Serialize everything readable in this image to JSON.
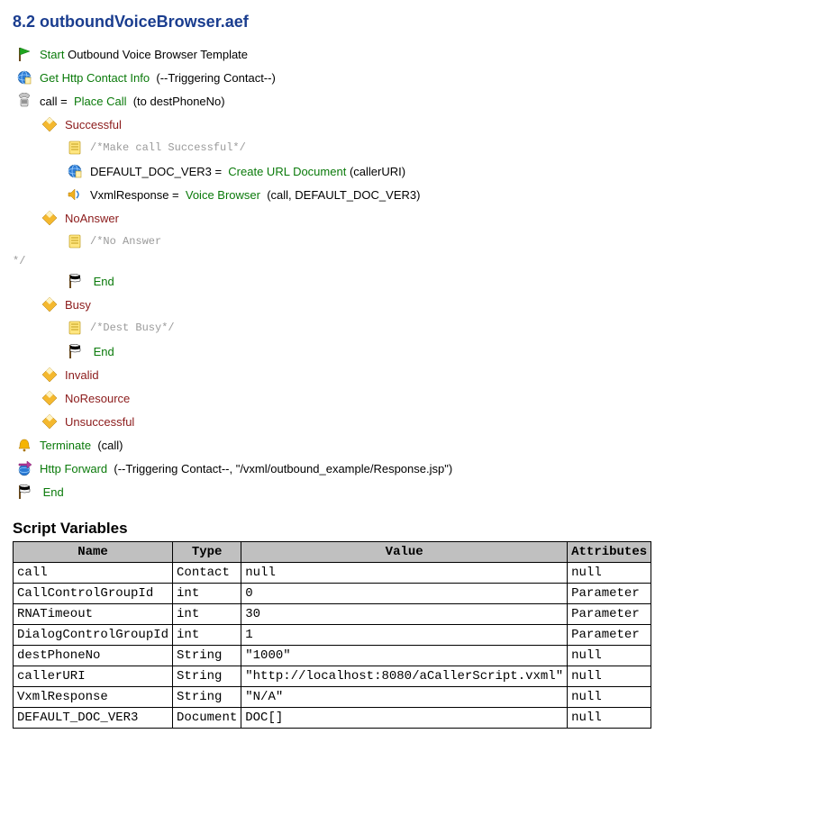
{
  "heading": "8.2 outboundVoiceBrowser.aef",
  "tree": {
    "start_action": "Start",
    "start_label": "Outbound Voice Browser Template",
    "gethttp_action": "Get Http Contact Info",
    "gethttp_args": "(--Triggering Contact--)",
    "call_assign": "call = ",
    "placecall_action": "Place Call",
    "placecall_args": "(to destPhoneNo)",
    "successful": "Successful",
    "cmt_success": "/*Make call Successful*/",
    "defdoc_assign": "DEFAULT_DOC_VER3 = ",
    "createurl_action": "Create URL Document",
    "createurl_args": "(callerURI)",
    "vxml_assign": "VxmlResponse = ",
    "voicebrowser_action": "Voice Browser",
    "voicebrowser_args": "(call, DEFAULT_DOC_VER3)",
    "noanswer": "NoAnswer",
    "cmt_noanswer": "/*No Answer",
    "cmt_noanswer_tail": "*/",
    "end": "End",
    "busy": "Busy",
    "cmt_busy": "/*Dest Busy*/",
    "invalid": "Invalid",
    "noresource": "NoResource",
    "unsuccessful": "Unsuccessful",
    "terminate_action": "Terminate",
    "terminate_args": "(call)",
    "httpfwd_action": "Http Forward",
    "httpfwd_args": "(--Triggering Contact--, \"/vxml/outbound_example/Response.jsp\")"
  },
  "vars_heading": "Script Variables",
  "vars_headers": {
    "name": "Name",
    "type": "Type",
    "value": "Value",
    "attrs": "Attributes"
  },
  "vars": [
    {
      "name": "call",
      "type": "Contact",
      "value": "null",
      "attrs": "null"
    },
    {
      "name": "CallControlGroupId",
      "type": "int",
      "value": "0",
      "attrs": "Parameter"
    },
    {
      "name": "RNATimeout",
      "type": "int",
      "value": "30",
      "attrs": "Parameter"
    },
    {
      "name": "DialogControlGroupId",
      "type": "int",
      "value": "1",
      "attrs": "Parameter"
    },
    {
      "name": "destPhoneNo",
      "type": "String",
      "value": "\"1000\"",
      "attrs": "null"
    },
    {
      "name": "callerURI",
      "type": "String",
      "value": "\"http://localhost:8080/aCallerScript.vxml\"",
      "attrs": "null"
    },
    {
      "name": "VxmlResponse",
      "type": "String",
      "value": "\"N/A\"",
      "attrs": "null"
    },
    {
      "name": "DEFAULT_DOC_VER3",
      "type": "Document",
      "value": "DOC[]",
      "attrs": "null"
    }
  ]
}
